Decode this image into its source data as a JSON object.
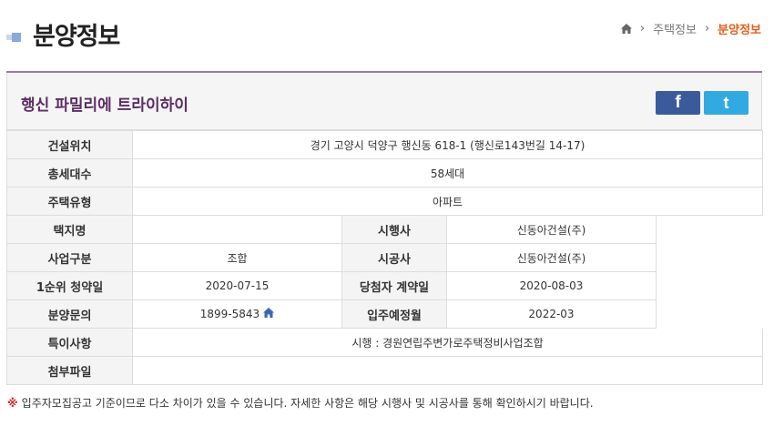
{
  "header": {
    "title": "분양정보",
    "breadcrumb": {
      "home_icon": "home-icon",
      "section": "주택정보",
      "current": "분양정보"
    }
  },
  "detail": {
    "name": "행신 파밀리에 트라이하이",
    "share": {
      "facebook_label": "f",
      "twitter_label": "t"
    },
    "rows": {
      "location": {
        "label": "건설위치",
        "value": "경기 고양시 덕양구 행신동 618-1 (행신로143번길 14-17)"
      },
      "households": {
        "label": "총세대수",
        "value": "58세대"
      },
      "housing_type": {
        "label": "주택유형",
        "value": "아파트"
      },
      "site_name": {
        "label": "택지명",
        "value": ""
      },
      "developer": {
        "label": "시행사",
        "value": "신동아건설(주)"
      },
      "business_type": {
        "label": "사업구분",
        "value": "조합"
      },
      "builder": {
        "label": "시공사",
        "value": "신동아건설(주)"
      },
      "first_subscription": {
        "label": "1순위 청약일",
        "value": "2020-07-15"
      },
      "winner_contract": {
        "label": "당첨자 계약일",
        "value": "2020-08-03"
      },
      "inquiry": {
        "label": "분양문의",
        "value": "1899-5843"
      },
      "move_in": {
        "label": "입주예정월",
        "value": "2022-03"
      },
      "remarks": {
        "label": "특이사항",
        "value": "시행 : 경원연립주변가로주택정비사업조합"
      },
      "attachments": {
        "label": "첨부파일",
        "value": ""
      }
    }
  },
  "notice": {
    "mark": "※",
    "text": "입주자모집공고 기준이므로 다소 차이가 있을 수 있습니다. 자세한 사항은 해당 시행사 및 시공사를 통해 확인하시기 바랍니다."
  },
  "colors": {
    "accent_orange": "#e4601c",
    "title_purple": "#5a2e63",
    "facebook_blue": "#3b5a9a",
    "twitter_blue": "#31aae1",
    "notice_red": "#d9272e"
  }
}
